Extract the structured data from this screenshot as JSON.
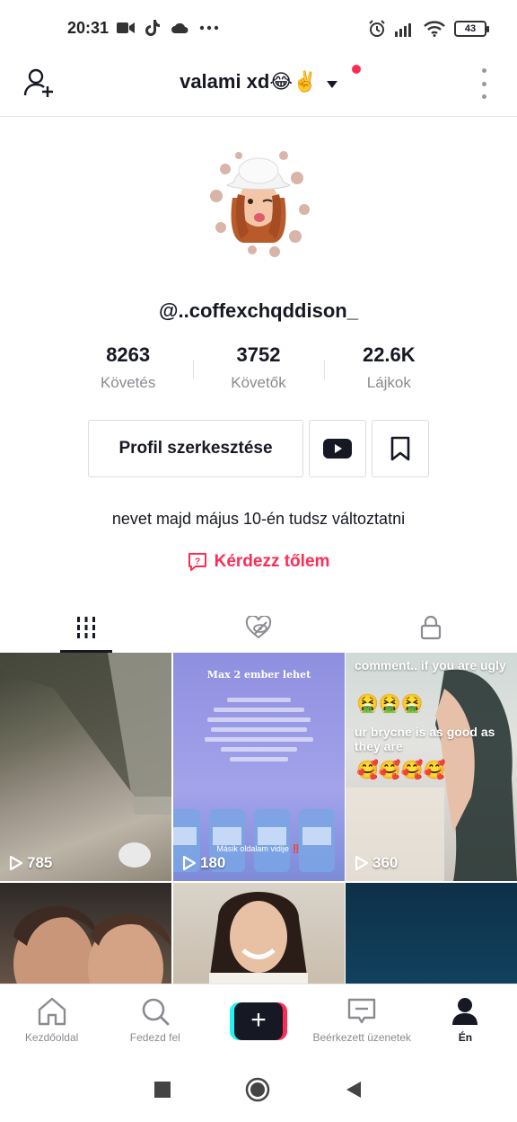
{
  "status_bar": {
    "time": "20:31",
    "battery": "43",
    "icons_left": [
      "video-icon",
      "tiktok-icon",
      "cloud-icon",
      "more-dots-icon"
    ],
    "icons_right": [
      "alarm-icon",
      "signal-icon",
      "wifi-icon",
      "battery-icon"
    ]
  },
  "header": {
    "title": "valami xd😂✌️",
    "add_user_icon": "add-user-icon",
    "menu_icon": "kebab-menu-icon"
  },
  "profile": {
    "username": "@..coffexchqddison_",
    "stats": [
      {
        "value": "8263",
        "label": "Követés"
      },
      {
        "value": "3752",
        "label": "Követők"
      },
      {
        "value": "22.6K",
        "label": "Lájkok"
      }
    ],
    "edit_button": "Profil szerkesztése",
    "bio": "nevet majd május 10-én tudsz változtatni",
    "ask_label": "Kérdezz tőlem"
  },
  "tabs": [
    {
      "icon": "grid-icon",
      "active": true
    },
    {
      "icon": "liked-hidden-icon",
      "active": false
    },
    {
      "icon": "lock-icon",
      "active": false
    }
  ],
  "videos": [
    {
      "views": "785"
    },
    {
      "views": "180",
      "overlay_title": "Max 2 ember lehet",
      "overlay_ribbon": "Másik oldalam vidije ‼️"
    },
    {
      "views": "360",
      "overlay_line1": "comment.. if you are ugly",
      "overlay_line2": "ur brycne is as good as they are"
    },
    {
      "views": ""
    },
    {
      "views": ""
    },
    {
      "views": ""
    }
  ],
  "bottom_nav": [
    {
      "label": "Kezdőoldal",
      "icon": "home-icon"
    },
    {
      "label": "Fedezd fel",
      "icon": "search-icon"
    },
    {
      "label": "",
      "icon": "plus-icon"
    },
    {
      "label": "Beérkezett üzenetek",
      "icon": "inbox-icon"
    },
    {
      "label": "Én",
      "icon": "profile-icon"
    }
  ],
  "colors": {
    "accent": "#fe2c55",
    "text": "#161823",
    "muted": "#8a8b91"
  }
}
